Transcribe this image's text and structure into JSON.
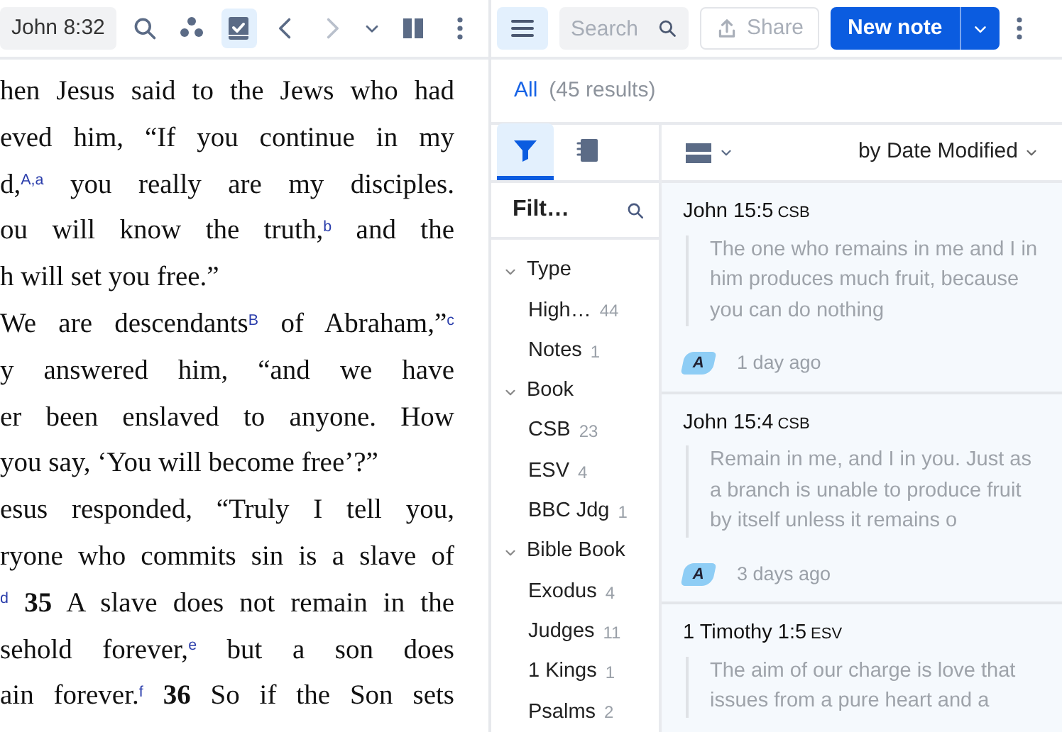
{
  "reader": {
    "reference": "John 8:32",
    "tools": [
      {
        "kind": "search",
        "selected": false,
        "disabled": false
      },
      {
        "kind": "cluster",
        "selected": false,
        "disabled": false
      },
      {
        "kind": "notes",
        "selected": true,
        "disabled": false
      },
      {
        "kind": "back",
        "selected": false,
        "disabled": false
      },
      {
        "kind": "forward",
        "selected": false,
        "disabled": true
      },
      {
        "kind": "history",
        "selected": false,
        "disabled": false
      },
      {
        "kind": "layout",
        "selected": false,
        "disabled": false
      },
      {
        "kind": "more",
        "selected": false,
        "disabled": false
      }
    ],
    "lines": [
      {
        "text": "hen Jesus said to the Jews who had",
        "justified": true
      },
      {
        "text": "eved him, “If you continue in my",
        "justified": true
      },
      {
        "text": "d,$^{A,a}$ you really are my disciples.",
        "justified": true
      },
      {
        "text": "ou will know the truth,$^{b}$ and the",
        "justified": true
      },
      {
        "text": "h will set you free.”",
        "justified": false
      },
      {
        "text": "We are descendants$^{B}$ of Abraham,”$^{c}$",
        "justified": true
      },
      {
        "text": "y answered him, “and we have",
        "justified": true
      },
      {
        "text": "er been enslaved to anyone. How",
        "justified": true
      },
      {
        "text": "you say, ‘You will become free’?”",
        "justified": false
      },
      {
        "text": "esus responded, “Truly I tell you,",
        "justified": true
      },
      {
        "text": "ryone who commits sin is a slave of",
        "justified": true
      },
      {
        "text": "$^{d}$ **35** A slave does not remain in the",
        "justified": true
      },
      {
        "text": "sehold forever,$^{e}$ but a son does",
        "justified": true
      },
      {
        "text": "ain forever.$^{f}$ **36** So if the Son sets",
        "justified": true
      }
    ]
  },
  "notes_toolbar": {
    "menu_active": true,
    "search": {
      "placeholder": "Search"
    },
    "share": {
      "label": "Share",
      "disabled": true
    },
    "new_note": {
      "label": "New note"
    }
  },
  "results": {
    "scope": "All",
    "count": "(45 results)"
  },
  "panel_tabs": [
    {
      "kind": "filter",
      "selected": true
    },
    {
      "kind": "notebook",
      "selected": false
    }
  ],
  "filters": {
    "title": "Filt…",
    "groups": [
      {
        "label": "Type",
        "expanded": true,
        "children": [
          {
            "label": "High…",
            "count": "44"
          },
          {
            "label": "Notes",
            "count": "1"
          }
        ]
      },
      {
        "label": "Book",
        "expanded": true,
        "children": [
          {
            "label": "CSB",
            "count": "23"
          },
          {
            "label": "ESV",
            "count": "4"
          },
          {
            "label": "BBC Jdg",
            "count": "1"
          }
        ]
      },
      {
        "label": "Bible Book",
        "expanded": true,
        "children": [
          {
            "label": "Exodus",
            "count": "4"
          },
          {
            "label": "Judges",
            "count": "11"
          },
          {
            "label": "1 Kings",
            "count": "1"
          },
          {
            "label": "Psalms",
            "count": "2"
          }
        ]
      }
    ]
  },
  "sort": {
    "label": "by Date Modified"
  },
  "notes": [
    {
      "reference": "John 15:5",
      "version": "CSB",
      "quote": "The one who remains in me and I in him produces much fruit, because you can do nothing",
      "author_initial": "A",
      "time": "1 day ago"
    },
    {
      "reference": "John 15:4",
      "version": "CSB",
      "quote": "Remain in me, and I in you. Just as a branch is unable to produce fruit by itself unless it remains o",
      "author_initial": "A",
      "time": "3 days ago"
    },
    {
      "reference": "1 Timothy 1:5",
      "version": "ESV",
      "quote": "The aim of our charge is love that issues from a pure heart and a"
    }
  ]
}
